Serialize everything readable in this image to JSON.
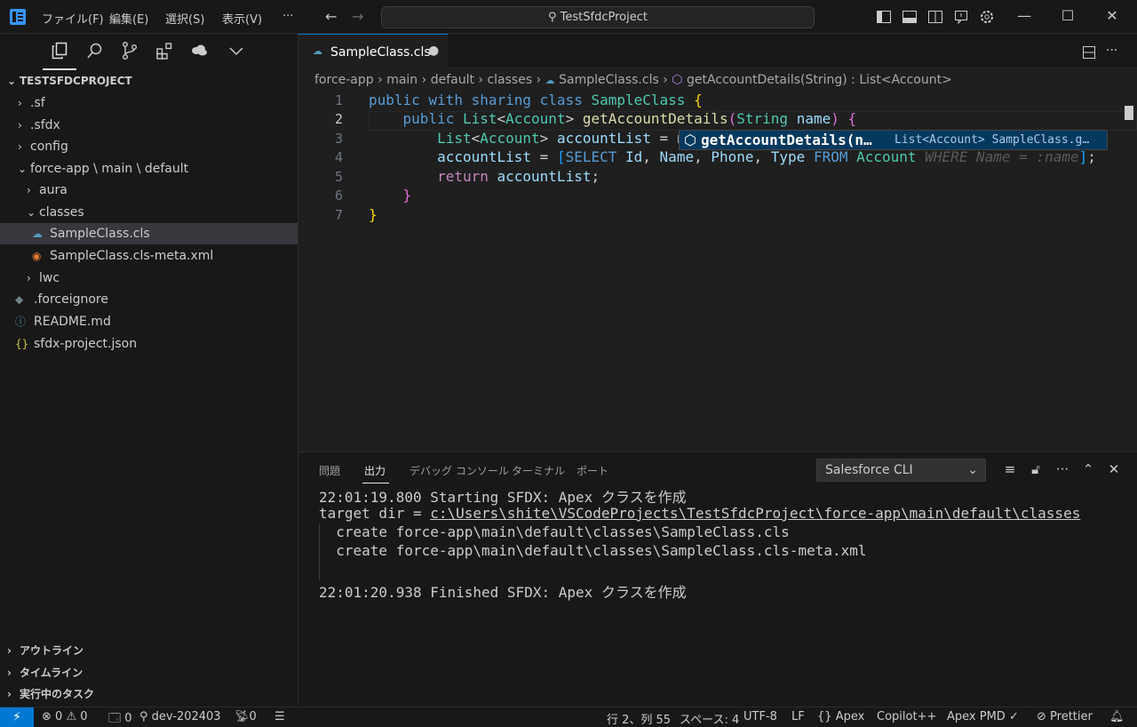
{
  "title_bar": {
    "menu": [
      "ファイル(F)",
      "編集(E)",
      "選択(S)",
      "表示(V)"
    ],
    "more": "···",
    "search_text": "TestSfdcProject"
  },
  "sidebar": {
    "explorer_title": "TESTSFDCPROJECT",
    "tree": [
      {
        "label": ".sf",
        "chevron": "›",
        "icon": ""
      },
      {
        "label": ".sfdx",
        "chevron": "›",
        "icon": ""
      },
      {
        "label": "config",
        "chevron": "›",
        "icon": ""
      },
      {
        "label": "force-app \\ main \\ default",
        "chevron": "⌄",
        "icon": ""
      },
      {
        "label": "aura",
        "chevron": "›",
        "icon": ""
      },
      {
        "label": "classes",
        "chevron": "⌄",
        "icon": ""
      },
      {
        "label": "SampleClass.cls",
        "chevron": "",
        "icon": "salesforce-file-icon"
      },
      {
        "label": "SampleClass.cls-meta.xml",
        "chevron": "",
        "icon": "rss-xml-icon"
      },
      {
        "label": "lwc",
        "chevron": "›",
        "icon": ""
      },
      {
        "label": ".forceignore",
        "chevron": "",
        "icon": "diamond-icon"
      },
      {
        "label": "README.md",
        "chevron": "",
        "icon": "info-icon"
      },
      {
        "label": "sfdx-project.json",
        "chevron": "",
        "icon": "json-icon"
      }
    ],
    "sections": [
      "アウトライン",
      "タイムライン",
      "実行中のタスク"
    ]
  },
  "editor": {
    "tab_label": "SampleClass.cls",
    "breadcrumb": [
      "force-app",
      "main",
      "default",
      "classes",
      "SampleClass.cls",
      "getAccountDetails(String) : List<Account>"
    ],
    "line_numbers": [
      "1",
      "2",
      "3",
      "4",
      "5",
      "6",
      "7"
    ],
    "suggestion": {
      "label": "getAccountDetails(n…",
      "detail": "List<Account> SampleClass.g…"
    }
  },
  "panel": {
    "tabs": [
      "問題",
      "出力",
      "デバッグ コンソール",
      "ターミナル",
      "ポート"
    ],
    "output_channel": "Salesforce CLI",
    "output_lines": [
      "22:01:19.800 Starting SFDX: Apex クラスを作成",
      "target dir = ",
      "  create force-app\\main\\default\\classes\\SampleClass.cls",
      "  create force-app\\main\\default\\classes\\SampleClass.cls-meta.xml",
      "",
      "22:01:20.938 Finished SFDX: Apex クラスを作成"
    ],
    "target_dir_link": "c:\\Users\\shite\\VSCodeProjects\\TestSfdcProject\\force-app\\main\\default\\classes"
  },
  "status_bar": {
    "errors": "0",
    "warnings": "0",
    "ports": "0",
    "branch": "dev-202403",
    "broadcast": "0",
    "position": "行 2、列 55",
    "spaces": "スペース: 4",
    "encoding": "UTF-8",
    "eol": "LF",
    "language": "Apex",
    "copilot": "Copilot++",
    "pmd": "Apex PMD ✓",
    "prettier": "Prettier"
  },
  "colors": {
    "accent": "#0078d4",
    "background": "#1f1f1f",
    "sidebar": "#181818"
  }
}
